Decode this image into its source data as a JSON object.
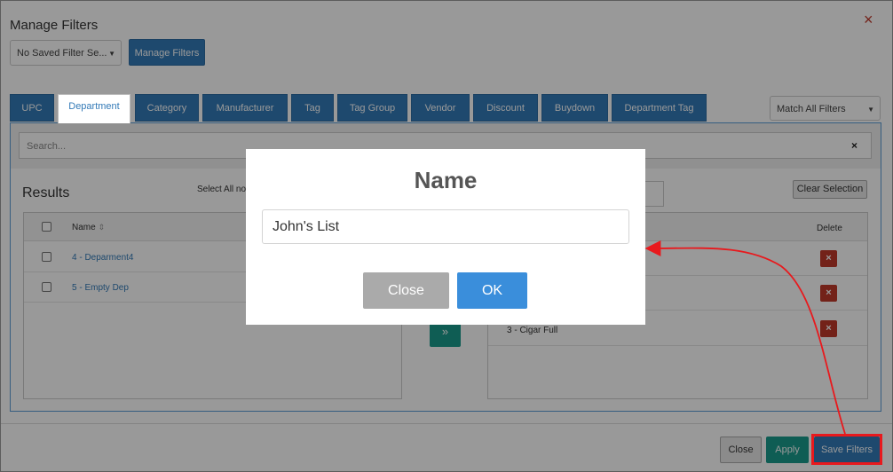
{
  "dialog": {
    "title": "Manage Filters",
    "saved_filter_select": "No Saved Filter Se...",
    "manage_filters_button": "Manage Filters",
    "tabs": [
      {
        "label": "UPC"
      },
      {
        "label": "Department"
      },
      {
        "label": "Category"
      },
      {
        "label": "Manufacturer"
      },
      {
        "label": "Tag"
      },
      {
        "label": "Tag Group"
      },
      {
        "label": "Vendor"
      },
      {
        "label": "Discount"
      },
      {
        "label": "Buydown"
      },
      {
        "label": "Department Tag"
      }
    ],
    "active_tab": "Department",
    "match_select": "Match All Filters",
    "search_placeholder": "Search...",
    "results_title": "Results",
    "select_all_label": "Select All no",
    "name_header": "Name",
    "result_rows": [
      {
        "label": "4 - Deparment4"
      },
      {
        "label": "5 - Empty Dep"
      }
    ],
    "clear_selection_button": "Clear Selection",
    "delete_header": "Delete",
    "selected_rows": [
      {
        "label": ""
      },
      {
        "label": ""
      },
      {
        "label": "3 - Cigar Full"
      }
    ],
    "footer": {
      "close_label": "Close",
      "apply_label": "Apply",
      "save_filters_label": "Save Filters"
    }
  },
  "name_modal": {
    "title": "Name",
    "input_value": "John's List",
    "close_label": "Close",
    "ok_label": "OK"
  },
  "icons": {
    "close": "×",
    "caret": "▼",
    "sort": "⇕",
    "move_right": "»",
    "delete": "×"
  },
  "colors": {
    "primary": "#337ab7",
    "teal": "#1a9b8c",
    "danger": "#c0392b",
    "annotation": "#e8191d"
  }
}
